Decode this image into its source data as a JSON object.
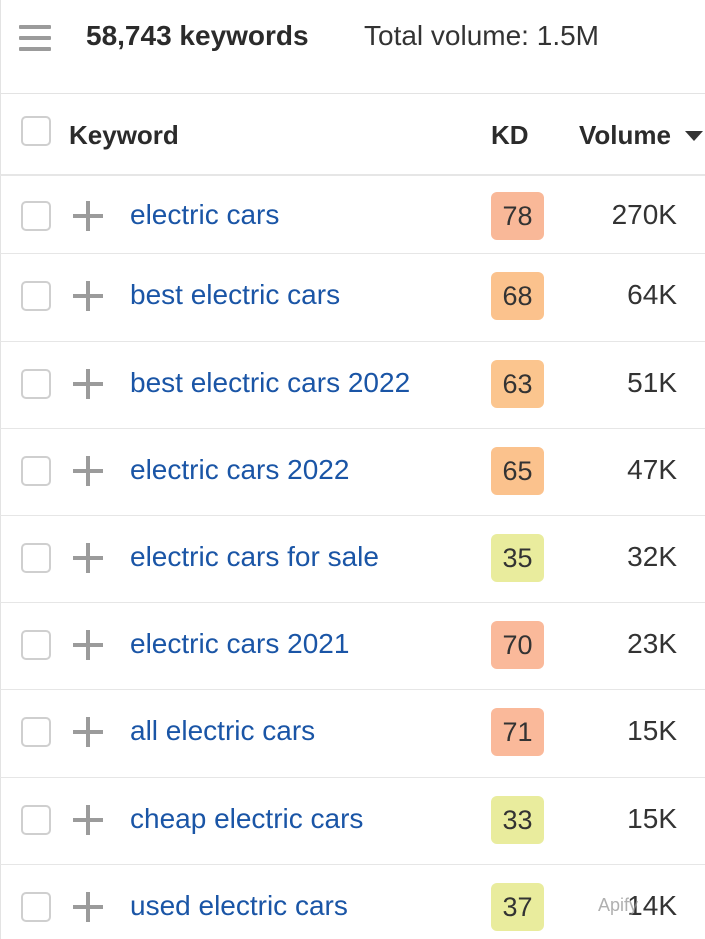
{
  "summary": {
    "keyword_count": "58,743 keywords",
    "total_volume": "Total volume: 1.5M"
  },
  "table": {
    "columns": {
      "keyword": "Keyword",
      "kd": "KD",
      "volume": "Volume"
    },
    "rows": [
      {
        "keyword": "electric cars",
        "kd": "78",
        "volume": "270K",
        "kd_color": "#f9b898"
      },
      {
        "keyword": "best electric cars",
        "kd": "68",
        "volume": "64K",
        "kd_color": "#fbc28d"
      },
      {
        "keyword": "best electric cars 2022",
        "kd": "63",
        "volume": "51K",
        "kd_color": "#fbc58e"
      },
      {
        "keyword": "electric cars 2022",
        "kd": "65",
        "volume": "47K",
        "kd_color": "#fbc28d"
      },
      {
        "keyword": "electric cars for sale",
        "kd": "35",
        "volume": "32K",
        "kd_color": "#e9ec9d"
      },
      {
        "keyword": "electric cars 2021",
        "kd": "70",
        "volume": "23K",
        "kd_color": "#fab99a"
      },
      {
        "keyword": "all electric cars",
        "kd": "71",
        "volume": "15K",
        "kd_color": "#fab99a"
      },
      {
        "keyword": "cheap electric cars",
        "kd": "33",
        "volume": "15K",
        "kd_color": "#e9ec9d"
      },
      {
        "keyword": "used electric cars",
        "kd": "37",
        "volume": "14K",
        "kd_color": "#e9ec9d"
      }
    ]
  },
  "watermark": "Apify",
  "colors": {
    "link": "#1a55a6",
    "icon_gray": "#9b9b9b"
  }
}
